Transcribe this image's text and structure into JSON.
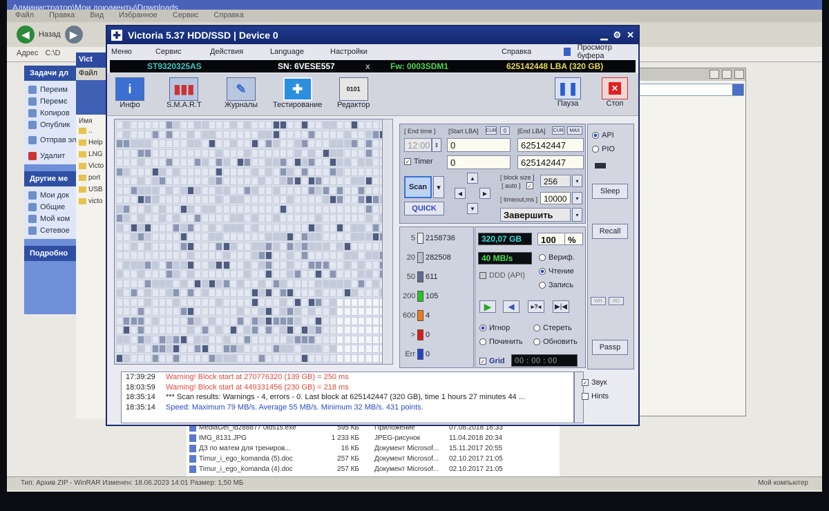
{
  "explorer": {
    "title_path": "Администратор\\Мои документы\\Downloads",
    "menu": [
      "Файл",
      "Правка",
      "Вид",
      "Избранное",
      "Сервис",
      "Справка"
    ],
    "back_label": "Назад",
    "address_label": "Адрес",
    "address_value": "C:\\D",
    "tasks_title": "Задачи дл",
    "tasks": [
      "Переим",
      "Перемє",
      "Копиров",
      "Опублик",
      "Отправ электро",
      "Удалит"
    ],
    "other_title": "Другие ме",
    "other": [
      "Мои док",
      "Общие",
      "Мой ком",
      "Сетевое"
    ],
    "details_title": "Подробно",
    "win2_title": "Vict",
    "win2_menu": "Файл",
    "name_col": "Имя",
    "tree": [
      "..",
      "Help",
      "LNG",
      "Victo",
      "port",
      "USB",
      "victo"
    ],
    "files": [
      {
        "name": "MediaGet_id288877 0ids1s.exe",
        "size": "595 КБ",
        "type": "Приложение",
        "date": "07.08.2018 16:33"
      },
      {
        "name": "IMG_8131.JPG",
        "size": "1 233 КБ",
        "type": "JPEG-рисунок",
        "date": "11.04.2018 20:34"
      },
      {
        "name": "ДЗ по матем для трениров...",
        "size": "16 КБ",
        "type": "Документ Microsof...",
        "date": "15.11.2017 20:55"
      },
      {
        "name": "Timur_i_ego_komanda (5).doc",
        "size": "257 КБ",
        "type": "Документ Microsof...",
        "date": "02.10.2017 21:05"
      },
      {
        "name": "Timur_i_ego_komanda (4).doc",
        "size": "257 КБ",
        "type": "Документ Microsof...",
        "date": "02.10.2017 21:05"
      }
    ],
    "status_left": "Тип: Архив ZIP - WinRAR Изменен: 18.06.2023 14:01 Размер: 1,50 МБ",
    "status_right": "Мой компьютер"
  },
  "victoria": {
    "title": "Victoria 5.37 HDD/SSD | Device 0",
    "menu": {
      "m1": "Меню",
      "m2": "Сервис",
      "m3": "Действия",
      "m4": "Language",
      "m5": "Настройки",
      "m6": "Справка",
      "m7": "Просмотр буфера"
    },
    "device": {
      "model": "ST9320325AS",
      "sn": "SN: 6VESE557",
      "x": "x",
      "fw": "Fw: 0003SDM1",
      "lba": "625142448 LBA (320 GB)"
    },
    "toolbar": {
      "info": "Инфо",
      "smart": "S.M.A.R.T",
      "logs": "Журналы",
      "test": "Тестирование",
      "editor": "Редактор",
      "pause": "Пауза",
      "stop": "Стоп"
    },
    "scan": {
      "end_time_label": "[ End time ]",
      "start_lba_label": "[Start LBA]",
      "end_lba_label": "[End LBA]",
      "cur_label": "CUR",
      "max_label": "MAX",
      "zero_label": "0",
      "end_time": "12:00",
      "start_lba": "0",
      "end_lba": "625142447",
      "timer_label": "Timer",
      "timer_value": "0",
      "end_lba2": "625142447",
      "scan_btn": "Scan",
      "quick_btn": "QUICK",
      "block_size_label": "[ block size ]",
      "auto_label": "[ auto ]",
      "block_size": "256",
      "timeout_label": "[ timeout,ms ]",
      "timeout": "10000",
      "action": "Завершить"
    },
    "side": {
      "api": "API",
      "pio": "PIO",
      "sleep": "Sleep",
      "recall": "Recall",
      "passp": "Passp",
      "wr": "WR",
      "rd": "RD"
    },
    "blocks": [
      {
        "label": "5",
        "count": "2158736",
        "color": "#e8ecf6"
      },
      {
        "label": "20",
        "count": "282508",
        "color": "#b7c0d4"
      },
      {
        "label": "50",
        "count": "611",
        "color": "#5e6c8e"
      },
      {
        "label": "200",
        "count": "105",
        "color": "#27c227"
      },
      {
        "label": "600",
        "count": "4",
        "color": "#f07a18"
      },
      {
        "label": ">",
        "count": "0",
        "color": "#e01818"
      },
      {
        "label": "Err",
        "count": "0",
        "color": "#2244cc"
      }
    ],
    "stats": {
      "size": "320,07 GB",
      "percent": "100",
      "percent_sign": "%",
      "speed": "40 MB/s",
      "ddd": "DDD (API)"
    },
    "modes": {
      "verify": "Вериф.",
      "read": "Чтение",
      "write": "Запись"
    },
    "actions": {
      "ignore": "Игнор",
      "erase": "Стереть",
      "repair": "Починить",
      "refresh": "Обновить"
    },
    "grid_label": "Grid",
    "elapsed": "00 : 00 : 00",
    "log": [
      {
        "time": "17:39:29",
        "text": "Warning! Block start at 270776320 (139 GB)  = 250 ms",
        "color": "#e0483a"
      },
      {
        "time": "18:03:59",
        "text": "Warning! Block start at 449331456 (230 GB)  = 218 ms",
        "color": "#e0483a"
      },
      {
        "time": "18:35:14",
        "text": "*** Scan results: Warnings - 4, errors - 0. Last block at 625142447 (320 GB), time 1 hours 27 minutes 44 ...",
        "color": "#222222"
      },
      {
        "time": "18:35:14",
        "text": "Speed: Maximum 79 MB/s. Average 55 MB/s. Minimum 32 MB/s. 431 points.",
        "color": "#2a48c8"
      }
    ],
    "sound_label": "Звук",
    "hints_label": "Hints"
  }
}
